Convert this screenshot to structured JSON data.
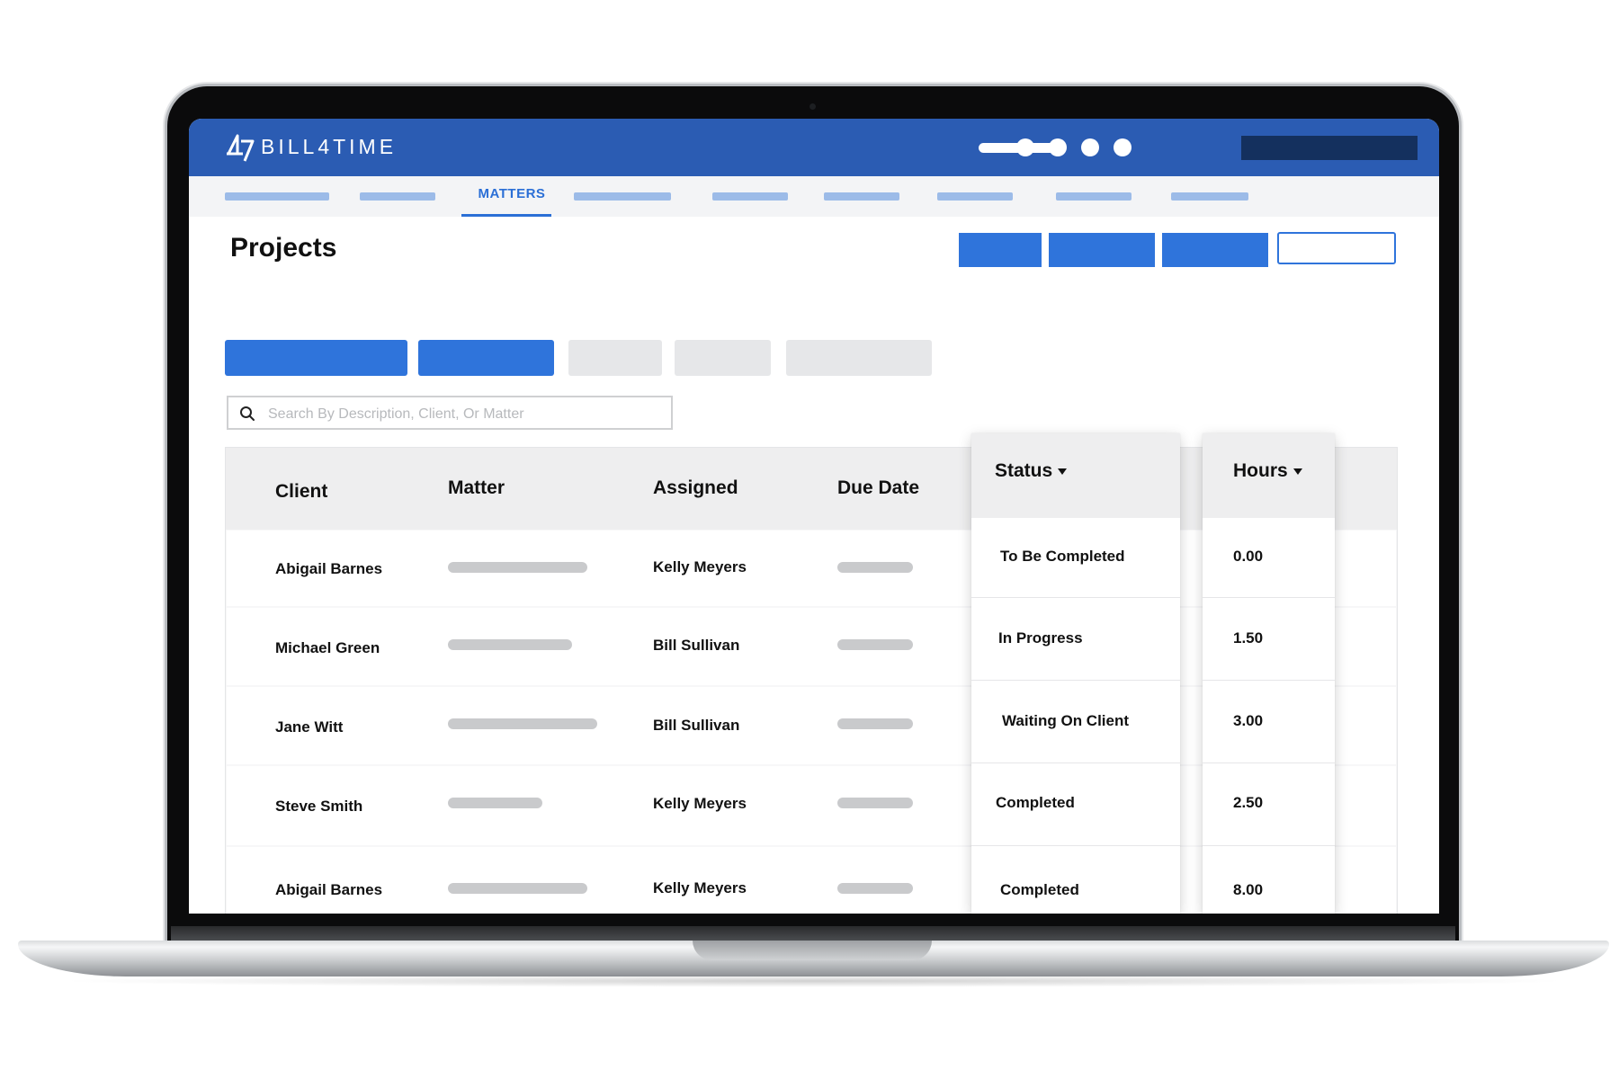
{
  "app": {
    "logo_text": "BILL4TIME"
  },
  "nav": {
    "active_label": "MATTERS"
  },
  "page": {
    "title": "Projects"
  },
  "search": {
    "placeholder": "Search By Description, Client, Or Matter"
  },
  "table": {
    "headers": {
      "client": "Client",
      "matter": "Matter",
      "assigned": "Assigned",
      "due_date": "Due Date",
      "status": "Status",
      "hours": "Hours"
    },
    "rows": [
      {
        "client": "Abigail Barnes",
        "assigned": "Kelly Meyers",
        "status": "To Be Completed",
        "hours": "0.00"
      },
      {
        "client": "Michael Green",
        "assigned": "Bill Sullivan",
        "status": "In Progress",
        "hours": "1.50"
      },
      {
        "client": "Jane Witt",
        "assigned": "Bill Sullivan",
        "status": "Waiting On Client",
        "hours": "3.00"
      },
      {
        "client": "Steve Smith",
        "assigned": "Kelly Meyers",
        "status": "Completed",
        "hours": "2.50"
      },
      {
        "client": "Abigail Barnes",
        "assigned": "Kelly Meyers",
        "status": "Completed",
        "hours": "8.00"
      }
    ]
  },
  "colors": {
    "brand_blue": "#2b5cb3",
    "accent_blue": "#2f74db",
    "nav_active": "#2b6fd6",
    "placeholder_bar": "#c9cacc"
  },
  "icons": {
    "logo": "bill4time-logo-icon",
    "search": "search-icon",
    "sort": "caret-down-icon"
  }
}
